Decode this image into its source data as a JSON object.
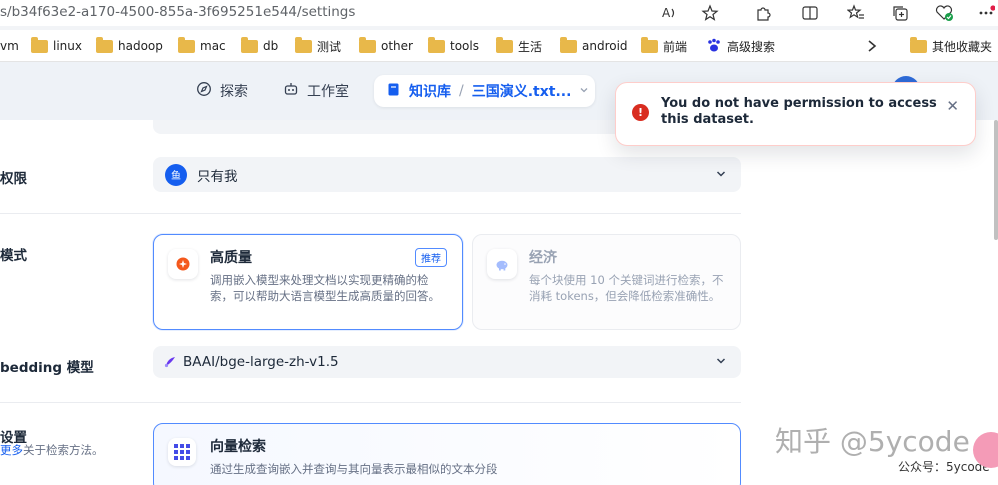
{
  "browser": {
    "url": "s/b34f63e2-a170-4500-855a-3f695251e544/settings",
    "bookmarks": [
      "vm",
      "linux",
      "hadoop",
      "mac",
      "db",
      "测试",
      "other",
      "tools",
      "生活",
      "android",
      "前端",
      "高级搜索"
    ],
    "other_bookmarks": "其他收藏夹",
    "toolbar_icons": [
      "read-aloud-icon",
      "favorite-star-icon",
      "extensions-icon",
      "split-screen-icon",
      "favorites-icon",
      "collections-icon",
      "browser-essentials-icon",
      "more-icon"
    ]
  },
  "header": {
    "nav": [
      {
        "label": "探索",
        "icon": "compass-icon"
      },
      {
        "label": "工作室",
        "icon": "robot-icon"
      }
    ],
    "knowledge_label": "知识库",
    "dataset_name": "三国演义.txt..."
  },
  "settings": {
    "permission": {
      "label": "权限",
      "value": "只有我",
      "avatar_text": "鱼"
    },
    "mode": {
      "label": "模式",
      "options": [
        {
          "title": "高质量",
          "badge": "推荐",
          "description": "调用嵌入模型来处理文档以实现更精确的检索，可以帮助大语言模型生成高质量的回答。",
          "selected": true
        },
        {
          "title": "经济",
          "description": "每个块使用 10 个关键词进行检索，不消耗 tokens，但会降低检索准确性。",
          "selected": false
        }
      ]
    },
    "embedding": {
      "label": "bedding 模型",
      "value": "BAAI/bge-large-zh-v1.5"
    },
    "retrieval": {
      "label": "设置",
      "link_text": "更多",
      "sub_text": "关于检索方法。",
      "option_title": "向量检索",
      "option_desc": "通过生成查询嵌入并查询与其向量表示最相似的文本分段"
    }
  },
  "toast": {
    "message": "You do not have permission to access this dataset."
  },
  "watermark": {
    "main": "知乎 @5ycode",
    "sub": "公众号：5ycode"
  },
  "colors": {
    "accent": "#155eef",
    "error": "#d92d20"
  }
}
